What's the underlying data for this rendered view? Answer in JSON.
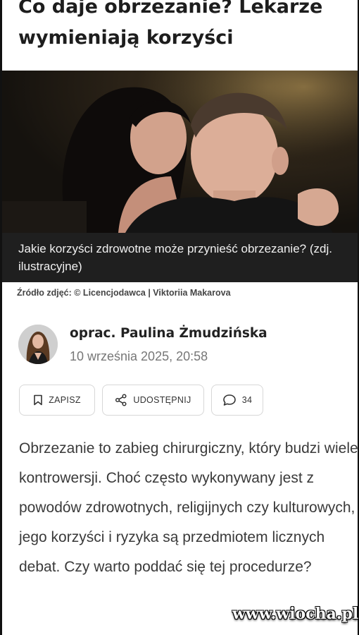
{
  "article": {
    "title": "Co daje obrzezanie? Lekarze wymieniają korzyści",
    "image_caption": "Jakie korzyści zdrowotne może przynieść obrzezanie? (zdj. ilustracyjne)",
    "image_source": "Źródło zdjęć: © Licencjodawca | Viktoriia Makarova",
    "author": "oprac. Paulina Żmudzińska",
    "date": "10 września 2025, 20:58",
    "body": "Obrzezanie to zabieg chirurgiczny, który budzi wiele kontrowersji. Choć często wykonywany jest z powodów zdrowotnych, religijnych czy kulturowych, jego korzyści i ryzyka są przedmiotem licznych debat. Czy warto poddać się tej procedurze?"
  },
  "actions": {
    "save_label": "ZAPISZ",
    "share_label": "UDOSTĘPNIJ",
    "comments_count": "34"
  },
  "icons": {
    "save": "bookmark-icon",
    "share": "share-icon",
    "comments": "speech-bubble-icon"
  },
  "watermark": "www.wiocha.pl",
  "colors": {
    "caption_background": "#1f1f1f",
    "button_border": "#d7d7d7",
    "date_text": "#777777"
  }
}
